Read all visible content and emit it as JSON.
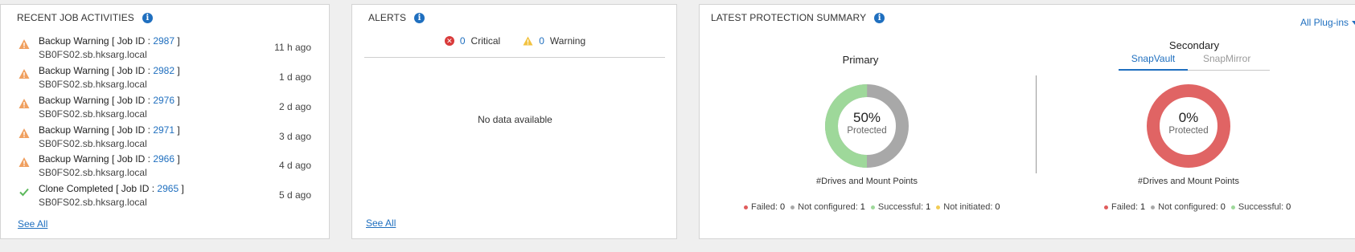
{
  "jobs_panel": {
    "title": "RECENT JOB ACTIVITIES",
    "items": [
      {
        "status": "Backup Warning",
        "job_prefix": "[ Job ID : ",
        "job_id": "2987",
        "job_suffix": " ]",
        "host": "SB0FS02.sb.hksarg.local",
        "age": "11 h ago",
        "icon": "warning-icon"
      },
      {
        "status": "Backup Warning",
        "job_prefix": "[ Job ID : ",
        "job_id": "2982",
        "job_suffix": " ]",
        "host": "SB0FS02.sb.hksarg.local",
        "age": "1 d ago",
        "icon": "warning-icon"
      },
      {
        "status": "Backup Warning",
        "job_prefix": "[ Job ID : ",
        "job_id": "2976",
        "job_suffix": " ]",
        "host": "SB0FS02.sb.hksarg.local",
        "age": "2 d ago",
        "icon": "warning-icon"
      },
      {
        "status": "Backup Warning",
        "job_prefix": "[ Job ID : ",
        "job_id": "2971",
        "job_suffix": " ]",
        "host": "SB0FS02.sb.hksarg.local",
        "age": "3 d ago",
        "icon": "warning-icon"
      },
      {
        "status": "Backup Warning",
        "job_prefix": "[ Job ID : ",
        "job_id": "2966",
        "job_suffix": " ]",
        "host": "SB0FS02.sb.hksarg.local",
        "age": "4 d ago",
        "icon": "warning-icon"
      },
      {
        "status": "Clone Completed",
        "job_prefix": "[ Job ID : ",
        "job_id": "2965",
        "job_suffix": " ]",
        "host": "SB0FS02.sb.hksarg.local",
        "age": "5 d ago",
        "icon": "checkmark-icon"
      }
    ],
    "see_all": "See All"
  },
  "alerts_panel": {
    "title": "ALERTS",
    "critical_count": "0",
    "critical_label": "Critical",
    "warning_count": "0",
    "warning_label": "Warning",
    "empty_text": "No data available",
    "see_all": "See All"
  },
  "summary_panel": {
    "title": "LATEST PROTECTION SUMMARY",
    "plugins_dropdown": "All Plug-ins",
    "primary": {
      "title": "Primary",
      "percent": "50%",
      "protected_label": "Protected",
      "caption": "#Drives and Mount Points",
      "protected_fraction": 0.5,
      "legend": [
        {
          "label": "Failed:",
          "value": "0",
          "color": "#e05c5c"
        },
        {
          "label": "Not configured:",
          "value": "1",
          "color": "#a8a8a8"
        },
        {
          "label": "Successful:",
          "value": "1",
          "color": "#9ed89a"
        },
        {
          "label": "Not initiated:",
          "value": "0",
          "color": "#f2cc55"
        }
      ]
    },
    "secondary": {
      "title": "Secondary",
      "tabs": [
        "SnapVault",
        "SnapMirror"
      ],
      "percent": "0%",
      "protected_label": "Protected",
      "caption": "#Drives and Mount Points",
      "protected_fraction": 0,
      "legend": [
        {
          "label": "Failed:",
          "value": "1",
          "color": "#e05c5c"
        },
        {
          "label": "Not configured:",
          "value": "0",
          "color": "#a8a8a8"
        },
        {
          "label": "Successful:",
          "value": "0",
          "color": "#9ed89a"
        }
      ]
    }
  },
  "colors": {
    "accent": "#1f6fbf",
    "warning": "#f0a060",
    "success": "#5cb85c",
    "critical": "#d93a3a",
    "donut_success": "#9ed89a",
    "donut_unconfigured": "#a8a8a8",
    "donut_failed": "#e06464"
  }
}
